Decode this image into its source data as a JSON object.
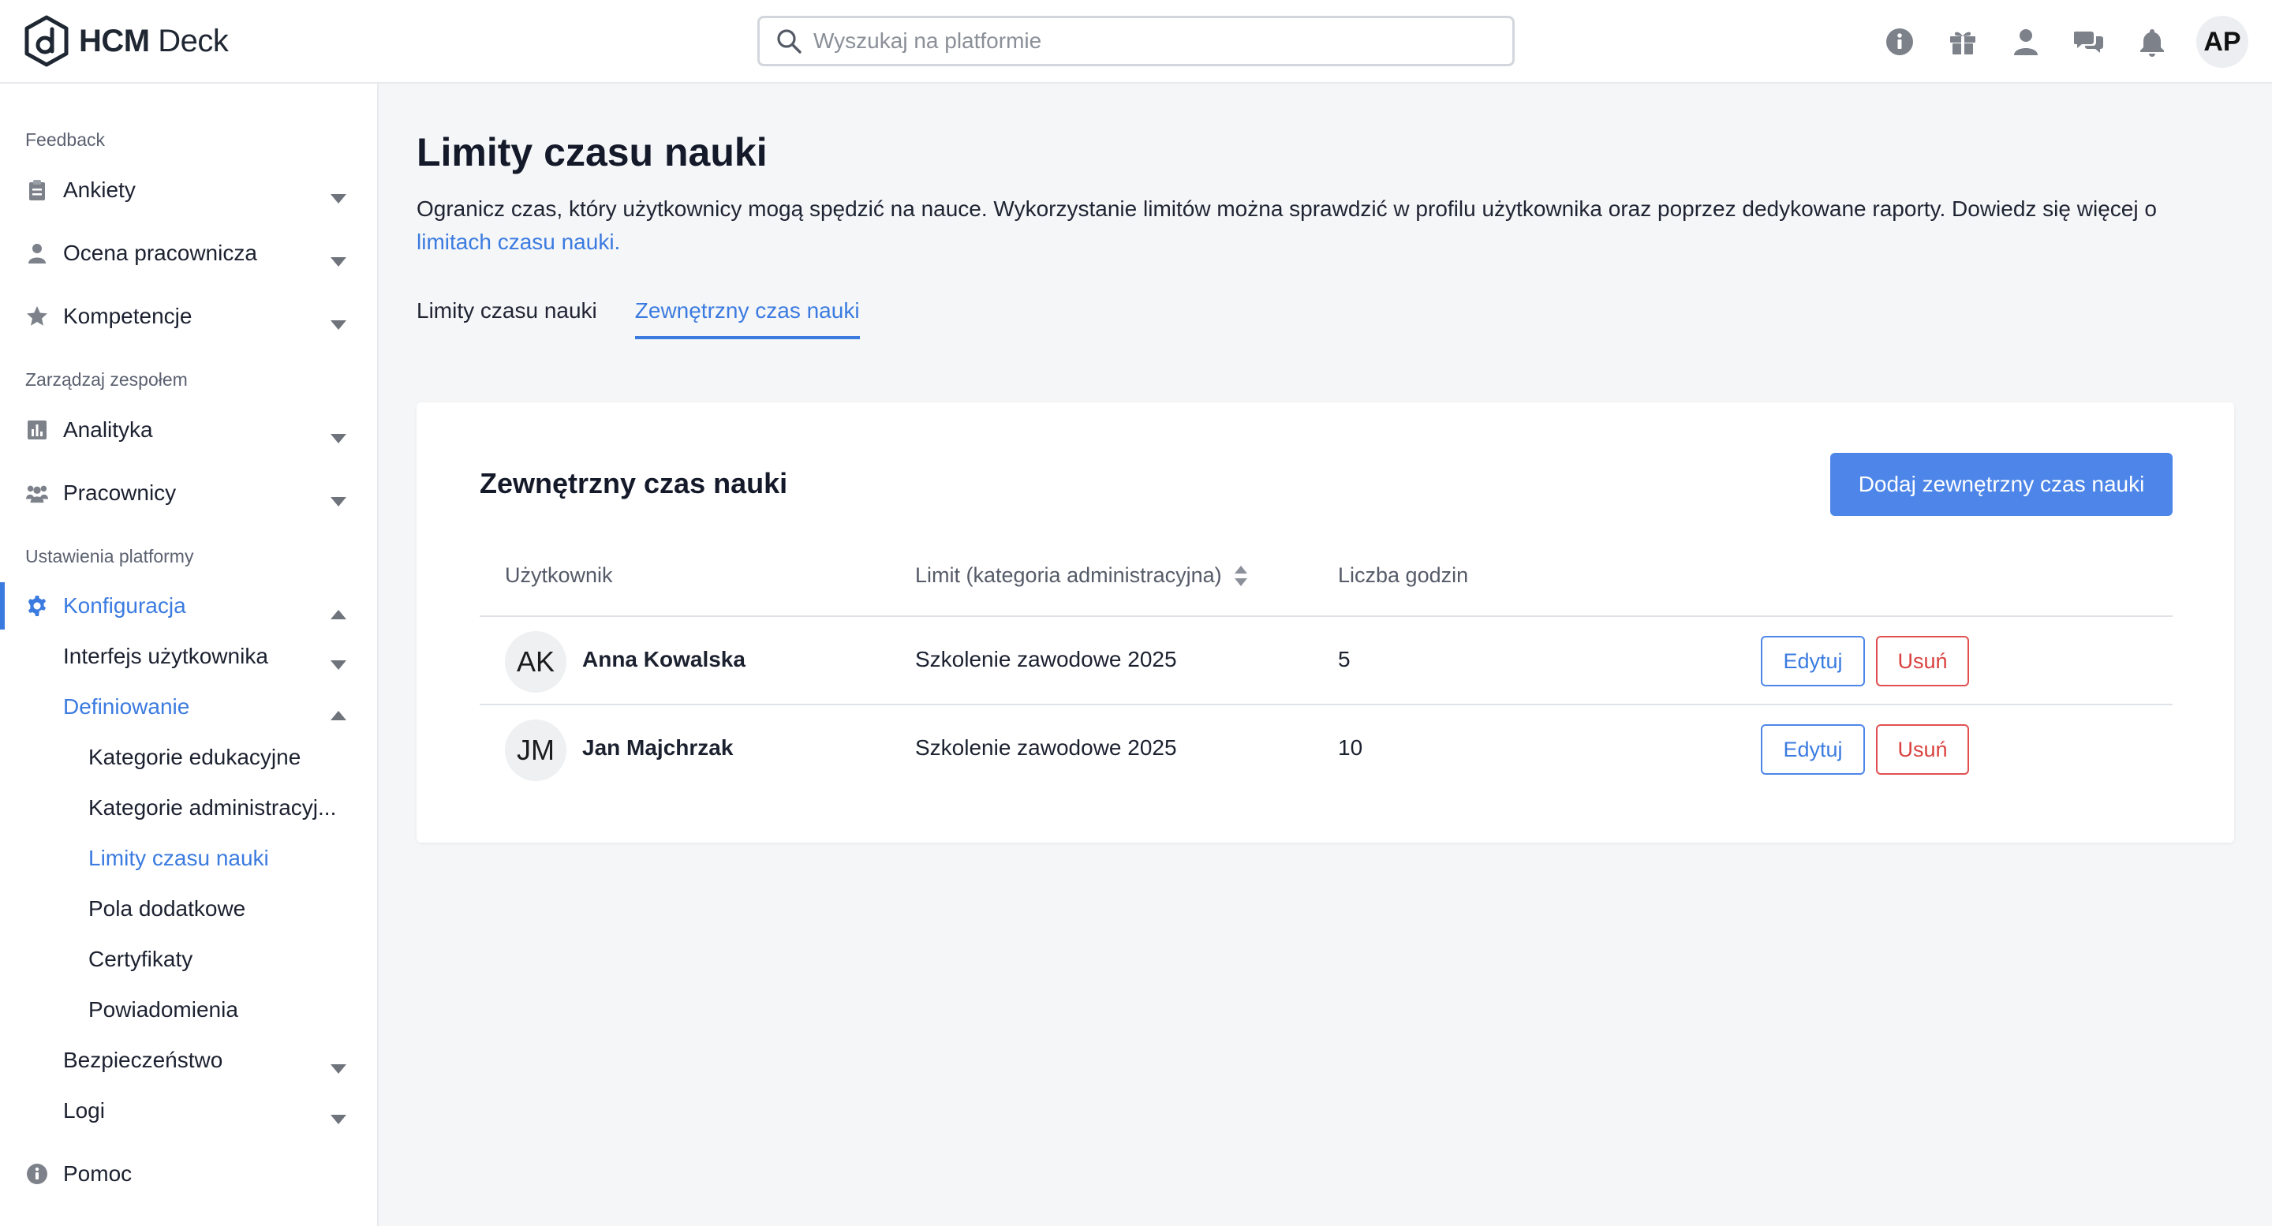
{
  "header": {
    "logo_bold": "HCM",
    "logo_light": " Deck",
    "search_placeholder": "Wyszukaj na platformie",
    "icons": [
      "info-icon",
      "gift-icon",
      "user-icon",
      "chat-icon",
      "bell-icon"
    ],
    "user_initials": "AP"
  },
  "sidebar": {
    "sections": {
      "feedback": "Feedback",
      "team": "Zarządzaj zespołem",
      "platform": "Ustawienia platformy"
    },
    "items": {
      "ankiety": "Ankiety",
      "ocena": "Ocena pracownicza",
      "kompetencje": "Kompetencje",
      "analityka": "Analityka",
      "pracownicy": "Pracownicy",
      "konfiguracja": "Konfiguracja",
      "interfejs": "Interfejs użytkownika",
      "definiowanie": "Definiowanie",
      "kategorie_edu": "Kategorie edukacyjne",
      "kategorie_adm": "Kategorie administracyj...",
      "limity": "Limity czasu nauki",
      "pola": "Pola dodatkowe",
      "certyfikaty": "Certyfikaty",
      "powiadomienia": "Powiadomienia",
      "bezpieczenstwo": "Bezpieczeństwo",
      "logi": "Logi",
      "pomoc": "Pomoc"
    }
  },
  "main": {
    "title": "Limity czasu nauki",
    "description": "Ogranicz czas, który użytkownicy mogą spędzić na nauce. Wykorzystanie limitów można sprawdzić w profilu użytkownika oraz poprzez dedykowane raporty. Dowiedz się więcej o ",
    "description_link": "limitach czasu nauki.",
    "tabs": [
      "Limity czasu nauki",
      "Zewnętrzny czas nauki"
    ],
    "card": {
      "title": "Zewnętrzny czas nauki",
      "add_button": "Dodaj zewnętrzny czas nauki",
      "columns": [
        "Użytkownik",
        "Limit (kategoria administracyjna)",
        "Liczba godzin"
      ],
      "rows": [
        {
          "initials": "AK",
          "name": "Anna Kowalska",
          "limit": "Szkolenie zawodowe 2025",
          "hours": "5",
          "edit": "Edytuj",
          "delete": "Usuń"
        },
        {
          "initials": "JM",
          "name": "Jan Majchrzak",
          "limit": "Szkolenie zawodowe 2025",
          "hours": "10",
          "edit": "Edytuj",
          "delete": "Usuń"
        }
      ]
    }
  },
  "colors": {
    "accent": "#3b7be0",
    "primary_button": "#4d86e8",
    "danger": "#d9423f"
  }
}
